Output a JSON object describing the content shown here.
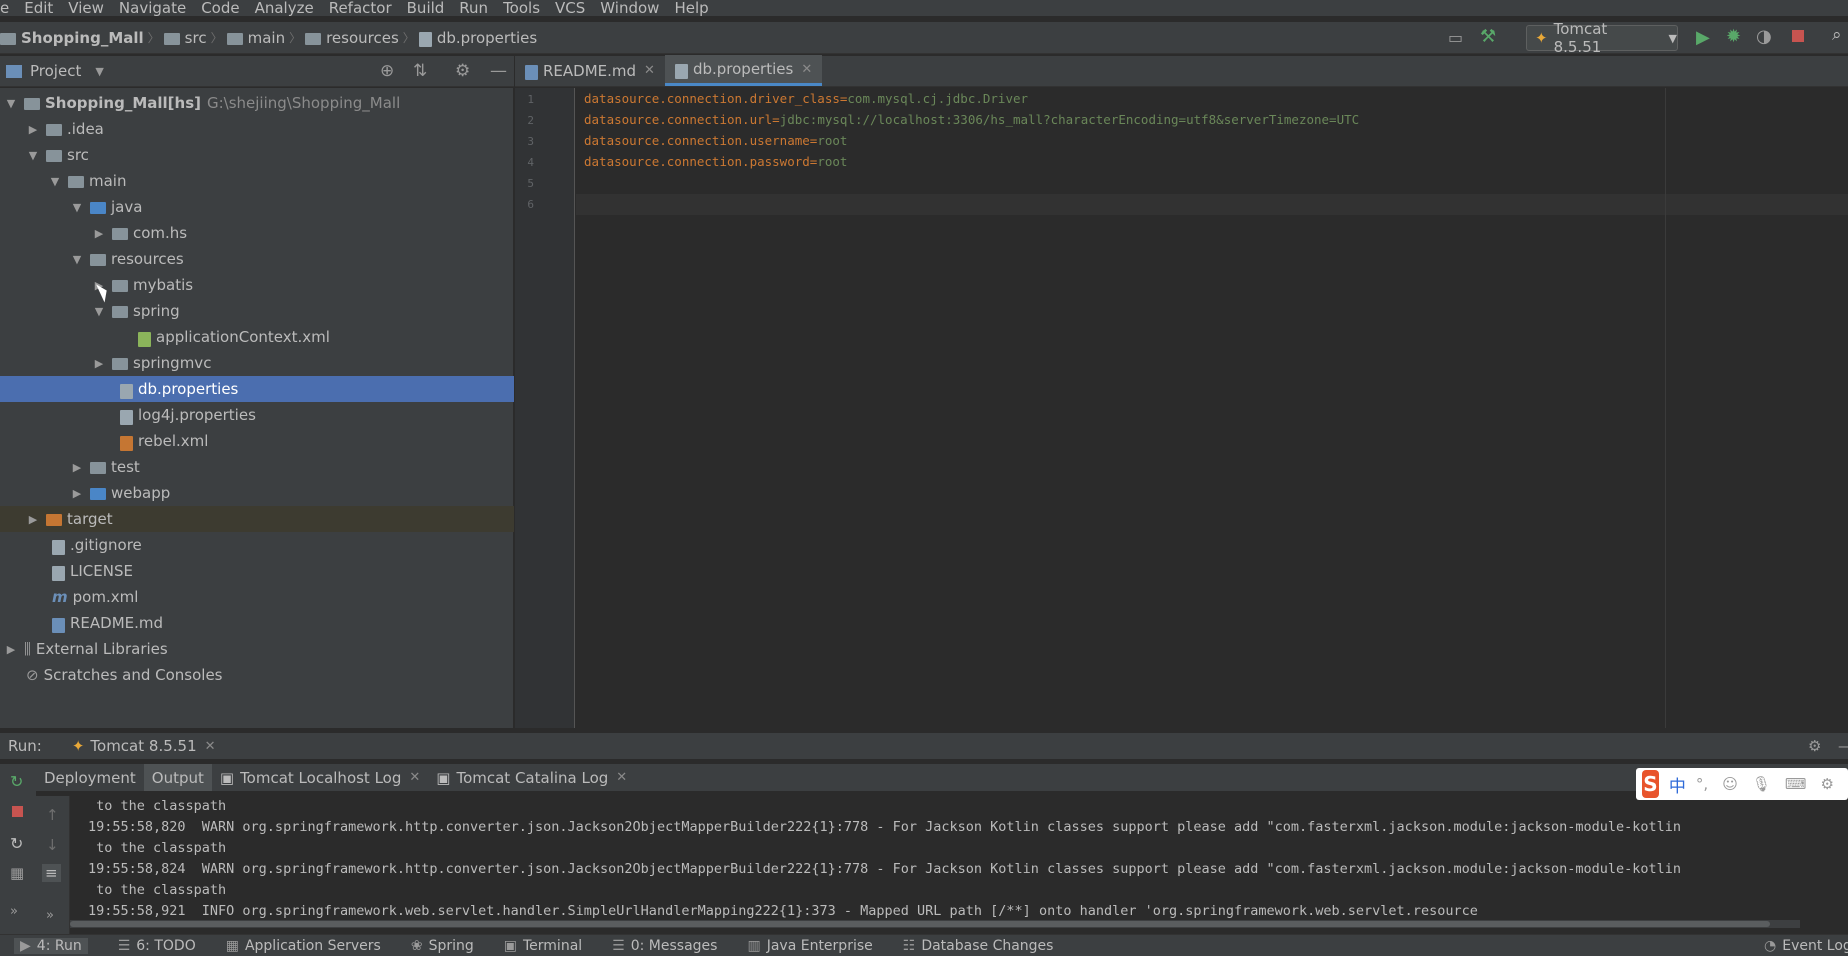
{
  "menu": [
    "e",
    "Edit",
    "View",
    "Navigate",
    "Code",
    "Analyze",
    "Refactor",
    "Build",
    "Run",
    "Tools",
    "VCS",
    "Window",
    "Help"
  ],
  "breadcrumb": [
    "Shopping_Mall",
    "src",
    "main",
    "resources",
    "db.properties"
  ],
  "run_config": {
    "label": "Tomcat 8.5.51"
  },
  "project_panel": {
    "title": "Project"
  },
  "tree": [
    {
      "label": "Shopping_Mall",
      "suffix": " [hs]",
      "path": "G:\\shejiing\\Shopping_Mall"
    },
    {
      "label": ".idea"
    },
    {
      "label": "src"
    },
    {
      "label": "main"
    },
    {
      "label": "java"
    },
    {
      "label": "com.hs"
    },
    {
      "label": "resources"
    },
    {
      "label": "mybatis"
    },
    {
      "label": "spring"
    },
    {
      "label": "applicationContext.xml"
    },
    {
      "label": "springmvc"
    },
    {
      "label": "db.properties"
    },
    {
      "label": "log4j.properties"
    },
    {
      "label": "rebel.xml"
    },
    {
      "label": "test"
    },
    {
      "label": "webapp"
    },
    {
      "label": "target"
    },
    {
      "label": ".gitignore"
    },
    {
      "label": "LICENSE"
    },
    {
      "label": "pom.xml"
    },
    {
      "label": "README.md"
    },
    {
      "label": "External Libraries"
    },
    {
      "label": "Scratches and Consoles"
    }
  ],
  "editor_tabs": [
    {
      "label": "README.md"
    },
    {
      "label": "db.properties"
    }
  ],
  "line_numbers": [
    "1",
    "2",
    "3",
    "4",
    "5",
    "6"
  ],
  "code": [
    {
      "key": "datasource.connection.driver_class",
      "eq": "=",
      "val": "com.mysql.cj.jdbc.Driver"
    },
    {
      "key": "datasource.connection.url",
      "eq": "=",
      "val": "jdbc:mysql://localhost:3306/hs_mall?characterEncoding=utf8&serverTimezone=UTC"
    },
    {
      "key": "datasource.connection.username",
      "eq": "=",
      "val": "root"
    },
    {
      "key": "datasource.connection.password",
      "eq": "=",
      "val": "root"
    }
  ],
  "run_panel": {
    "label": "Run:",
    "config": "Tomcat 8.5.51"
  },
  "run_tabs": [
    "Deployment",
    "Output",
    "Tomcat Localhost Log",
    "Tomcat Catalina Log"
  ],
  "console": [
    " to the classpath",
    "19:55:58,820  WARN org.springframework.http.converter.json.Jackson2ObjectMapperBuilder222{1}:778 - For Jackson Kotlin classes support please add \"com.fasterxml.jackson.module:jackson-module-kotlin",
    " to the classpath",
    "19:55:58,824  WARN org.springframework.http.converter.json.Jackson2ObjectMapperBuilder222{1}:778 - For Jackson Kotlin classes support please add \"com.fasterxml.jackson.module:jackson-module-kotlin",
    " to the classpath",
    "19:55:58,921  INFO org.springframework.web.servlet.handler.SimpleUrlHandlerMapping222{1}:373 - Mapped URL path [/**] onto handler 'org.springframework.web.servlet.resource"
  ],
  "status_bar": [
    {
      "label": "4: Run",
      "icon": "▶"
    },
    {
      "label": "6: TODO",
      "icon": "☰"
    },
    {
      "label": "Application Servers",
      "icon": "▦"
    },
    {
      "label": "Spring",
      "icon": "❀"
    },
    {
      "label": "Terminal",
      "icon": "▣"
    },
    {
      "label": "0: Messages",
      "icon": "☰"
    },
    {
      "label": "Java Enterprise",
      "icon": "▥"
    },
    {
      "label": "Database Changes",
      "icon": "☷"
    }
  ],
  "event_log": "Event Log",
  "ime": {
    "brand": "S",
    "lang": "中"
  },
  "colors": {
    "selection": "#4b6eaf",
    "key": "#cc7832",
    "value": "#6a8759",
    "bg": "#2b2b2b",
    "panel": "#3c3f41"
  }
}
